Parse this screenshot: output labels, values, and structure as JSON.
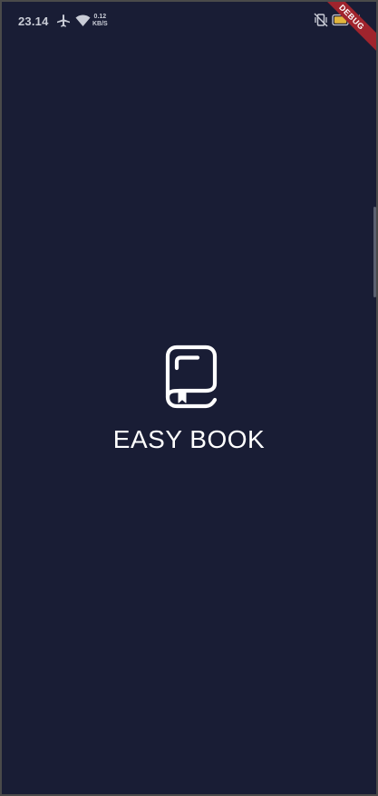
{
  "status_bar": {
    "time": "23.14",
    "net_speed_value": "0.12",
    "net_speed_unit": "KB/S",
    "icons": [
      "airplane-mode-icon",
      "wifi-icon",
      "vibrate-icon",
      "battery-icon",
      "charging-icon"
    ]
  },
  "debug_banner": {
    "label": "DEBUG",
    "color": "#a0242d"
  },
  "splash": {
    "app_name": "EASY BOOK",
    "logo_icon": "book-icon",
    "background_color": "#191d35",
    "text_color": "#ffffff"
  }
}
